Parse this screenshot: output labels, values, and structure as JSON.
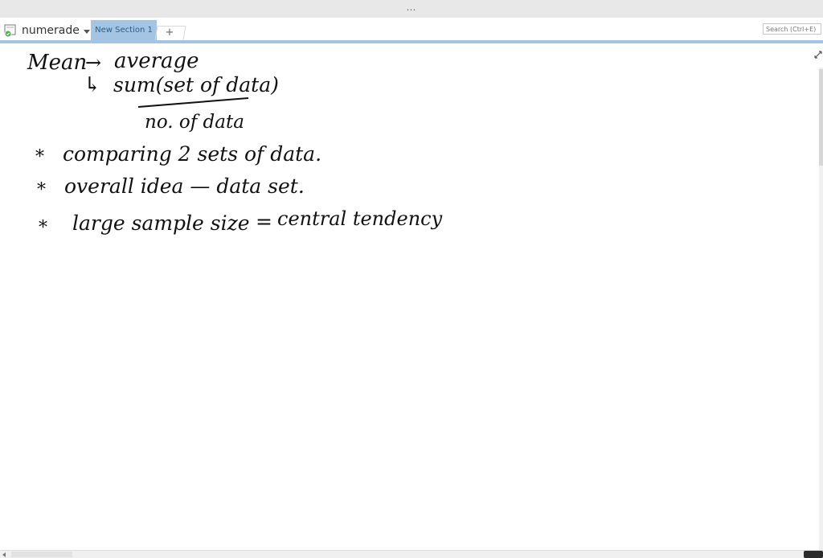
{
  "titlebar": {
    "dots": "…"
  },
  "notebook": {
    "name": "numerade"
  },
  "tabs": {
    "active_section": "New Section 1",
    "add_label": "+"
  },
  "search": {
    "placeholder": "Search (Ctrl+E)"
  },
  "icons": {
    "expand": "expand-icon",
    "notebook": "notebook-icon"
  },
  "notes": {
    "line1_left": "Mean",
    "line1_arrow": "→",
    "line1_right": "average",
    "line2_arrow": "↳",
    "line2_numerator": "sum(set of data)",
    "line2_denominator": "no. of data",
    "bullet_symbol": "*",
    "bullet1": "comparing 2 sets of data.",
    "bullet2": "overall idea — data set.",
    "bullet3_left": "large sample size",
    "bullet3_equals": "=",
    "bullet3_right": "central tendency"
  },
  "colors": {
    "section_tab_bg": "#a3c5e3",
    "section_tab_text": "#2f5b85",
    "ink": "#111111"
  }
}
